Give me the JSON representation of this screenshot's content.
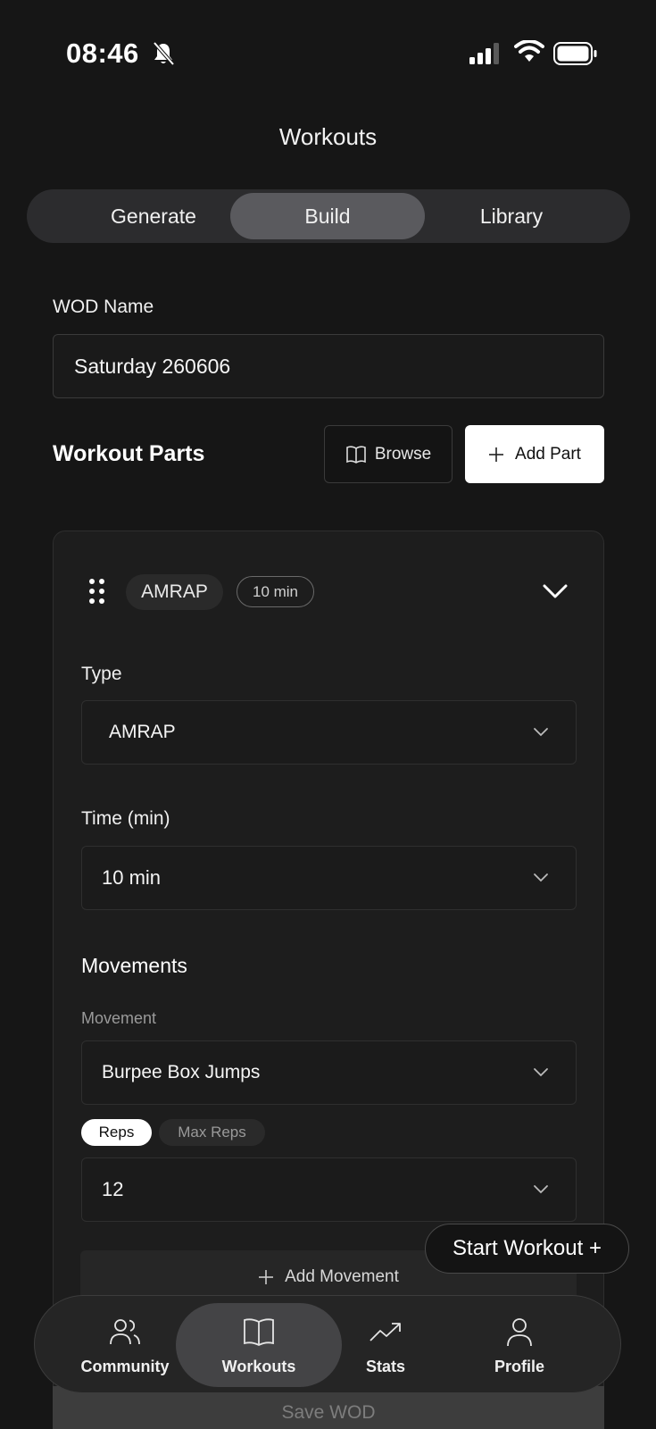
{
  "status_bar": {
    "time": "08:46",
    "icons": [
      "bell-slash-icon",
      "cellular-signal-icon",
      "wifi-icon",
      "battery-icon"
    ]
  },
  "header": {
    "title": "Workouts"
  },
  "tabs": [
    {
      "label": "Generate",
      "active": false
    },
    {
      "label": "Build",
      "active": true
    },
    {
      "label": "Library",
      "active": false
    }
  ],
  "wod_name": {
    "label": "WOD Name",
    "value": "Saturday 260606"
  },
  "workout_parts": {
    "title": "Workout Parts",
    "browse_label": "Browse",
    "add_part_label": "Add Part"
  },
  "part": {
    "type_chip": "AMRAP",
    "time_chip": "10 min",
    "type_label": "Type",
    "type_value": "AMRAP",
    "time_label": "Time (min)",
    "time_value": "10 min",
    "movements_title": "Movements",
    "movement_label": "Movement",
    "movement_value": "Burpee Box Jumps",
    "reps_toggle": [
      "Reps",
      "Max Reps"
    ],
    "reps_value": "12",
    "add_movement_label": "Add Movement"
  },
  "start_workout_label": "Start Workout +",
  "save_wod_label": "Save WOD",
  "bottom_nav": [
    {
      "label": "Community",
      "icon": "users-icon",
      "active": false
    },
    {
      "label": "Workouts",
      "icon": "book-icon",
      "active": true
    },
    {
      "label": "Stats",
      "icon": "trending-up-icon",
      "active": false
    },
    {
      "label": "Profile",
      "icon": "user-icon",
      "active": false
    }
  ],
  "colors": {
    "background": "#161616",
    "card": "#1d1d1d",
    "accent_white": "#ffffff",
    "active_tab": "#5a5a5e"
  }
}
